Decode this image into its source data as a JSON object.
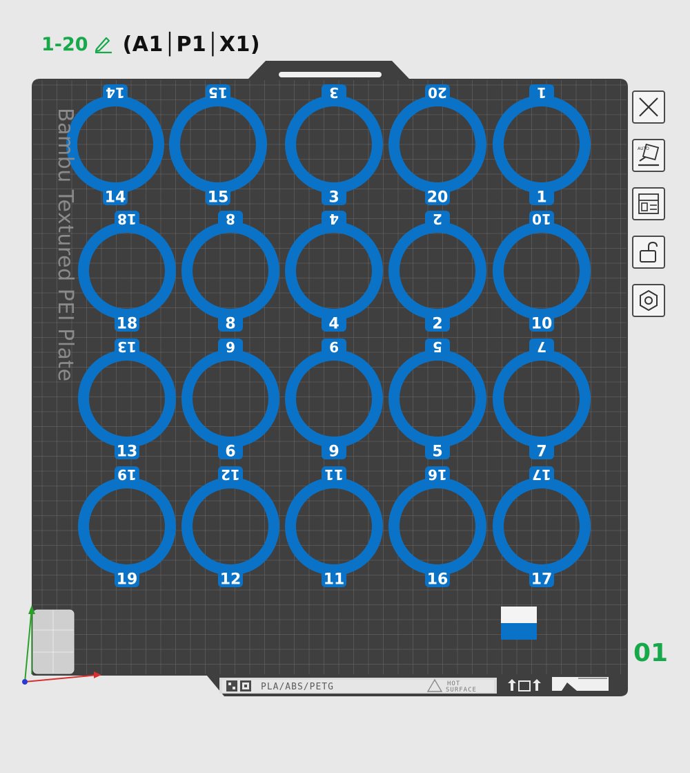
{
  "header": {
    "plate_name": "1-20",
    "compat_printers": "(A1│P1│X1)"
  },
  "plate": {
    "watermark": "Bambu Textured PEI Plate",
    "material_label": "PLA/ABS/PETG",
    "warning_line1": "HOT",
    "warning_line2": "SURFACE",
    "plate_number": "01"
  },
  "toolbar": {
    "buttons": [
      {
        "name": "close-icon"
      },
      {
        "name": "auto-orient-icon"
      },
      {
        "name": "arrange-icon"
      },
      {
        "name": "unlock-icon"
      },
      {
        "name": "settings-hex-icon"
      }
    ]
  },
  "objects": [
    {
      "row": 0,
      "col": 0,
      "label": "14"
    },
    {
      "row": 0,
      "col": 1,
      "label": "15"
    },
    {
      "row": 0,
      "col": 2,
      "label": "3"
    },
    {
      "row": 0,
      "col": 3,
      "label": "20"
    },
    {
      "row": 0,
      "col": 4,
      "label": "1"
    },
    {
      "row": 1,
      "col": 0,
      "label": "18"
    },
    {
      "row": 1,
      "col": 1,
      "label": "8"
    },
    {
      "row": 1,
      "col": 2,
      "label": "4"
    },
    {
      "row": 1,
      "col": 3,
      "label": "2"
    },
    {
      "row": 1,
      "col": 4,
      "label": "10"
    },
    {
      "row": 2,
      "col": 0,
      "label": "13"
    },
    {
      "row": 2,
      "col": 1,
      "label": "6"
    },
    {
      "row": 2,
      "col": 2,
      "label": "9"
    },
    {
      "row": 2,
      "col": 3,
      "label": "5"
    },
    {
      "row": 2,
      "col": 4,
      "label": "7"
    },
    {
      "row": 3,
      "col": 0,
      "label": "19"
    },
    {
      "row": 3,
      "col": 1,
      "label": "12"
    },
    {
      "row": 3,
      "col": 2,
      "label": "11"
    },
    {
      "row": 3,
      "col": 3,
      "label": "16"
    },
    {
      "row": 3,
      "col": 4,
      "label": "17"
    }
  ],
  "colors": {
    "object_blue": "#0b73c7",
    "plate_dark": "#3f3f3f",
    "grid_line": "#6a6a6a",
    "accent_green": "#17a84a",
    "axis_red": "#d63030",
    "axis_green": "#2aa02a",
    "axis_blue": "#2a3ad0"
  }
}
